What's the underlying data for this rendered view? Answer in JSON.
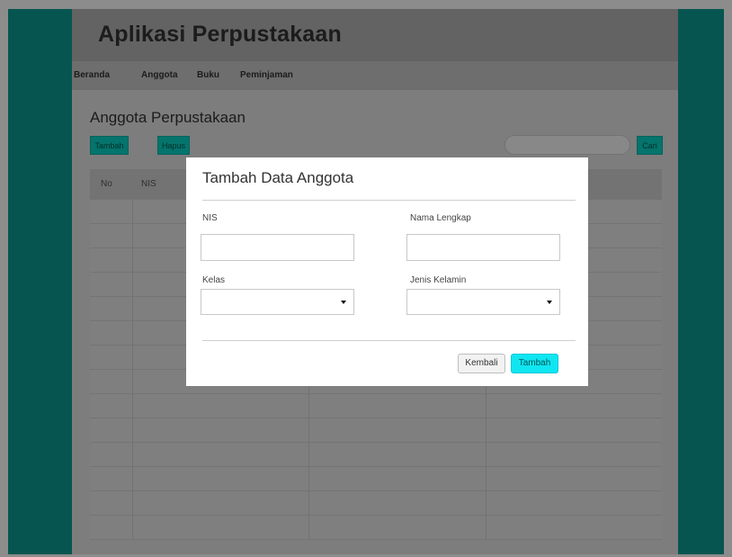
{
  "app": {
    "title": "Aplikasi Perpustakaan"
  },
  "nav": {
    "items": [
      "Beranda",
      "Anggota",
      "Buku",
      "Peminjaman"
    ]
  },
  "page": {
    "title": "Anggota Perpustakaan",
    "add_button": "Tambah",
    "delete_button": "Hapus",
    "search_placeholder": "",
    "search_button": "Cari"
  },
  "table": {
    "columns": [
      "No",
      "NIS",
      "",
      ""
    ],
    "rows": []
  },
  "modal": {
    "title": "Tambah Data Anggota",
    "nis_label": "NIS",
    "nis_value": "",
    "name_label": "Nama Lengkap",
    "name_value": "",
    "class_label": "Kelas",
    "class_value": "",
    "gender_label": "Jenis Kelamin",
    "gender_value": "",
    "back_button": "Kembali",
    "submit_button": "Tambah"
  },
  "colors": {
    "frame": "#0e9c92",
    "accent_button": "#08d4c5",
    "submit_button": "#0fe6f2"
  }
}
